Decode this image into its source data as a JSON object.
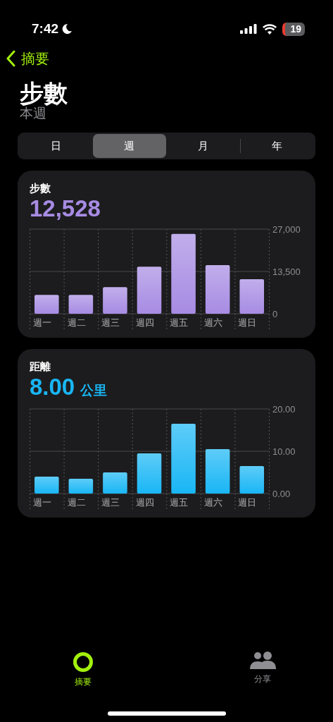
{
  "status_bar": {
    "time": "7:42",
    "battery": "19"
  },
  "nav": {
    "back_label": "摘要"
  },
  "title": "步數",
  "subtitle": "本週",
  "segments": [
    {
      "label": "日",
      "selected": false
    },
    {
      "label": "週",
      "selected": true
    },
    {
      "label": "月",
      "selected": false
    },
    {
      "label": "年",
      "selected": false
    }
  ],
  "cards": [
    {
      "label": "步數",
      "value": "12,528",
      "color": "#a78be3",
      "chart_data": {
        "type": "bar",
        "categories": [
          "週一",
          "週二",
          "週三",
          "週四",
          "週五",
          "週六",
          "週日"
        ],
        "series": [
          {
            "color": "#a78be3",
            "values": [
              6000,
              6000,
              8500,
              15000,
              25500,
              15500,
              11000
            ]
          }
        ],
        "ylim": [
          0,
          27000
        ],
        "yticks": [
          {
            "value": 0,
            "label": "0"
          },
          {
            "value": 13500,
            "label": "13,500"
          },
          {
            "value": 27000,
            "label": "27,000"
          }
        ]
      }
    },
    {
      "label": "距離",
      "value": "8.00",
      "unit": "公里",
      "color": "#19b6f5",
      "chart_data": {
        "type": "bar",
        "categories": [
          "週一",
          "週二",
          "週三",
          "週四",
          "週五",
          "週六",
          "週日"
        ],
        "series": [
          {
            "color": "#19b6f5",
            "values": [
              4,
              3.5,
              5,
              9.5,
              16.5,
              10.5,
              6.5
            ]
          }
        ],
        "ylim": [
          0,
          20
        ],
        "yticks": [
          {
            "value": 0,
            "label": "0.00"
          },
          {
            "value": 10,
            "label": "10.00"
          },
          {
            "value": 20,
            "label": "20.00"
          }
        ]
      }
    }
  ],
  "tab_bar": [
    {
      "label": "摘要",
      "selected": true,
      "kind": "ring"
    },
    {
      "label": "分享",
      "selected": false,
      "kind": "people"
    }
  ]
}
